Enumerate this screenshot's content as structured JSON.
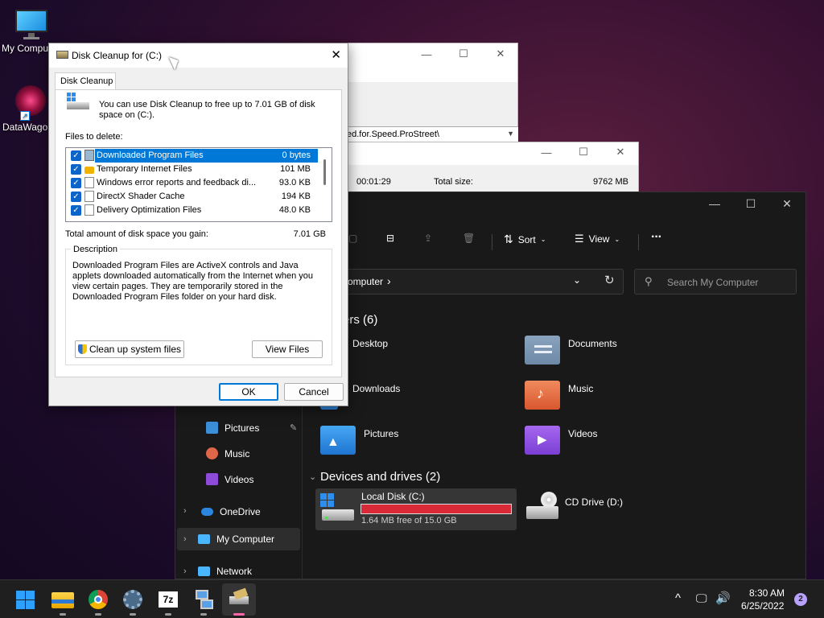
{
  "desktop": {
    "icons": [
      {
        "label": "My Computer"
      },
      {
        "label": "DataWagon"
      }
    ]
  },
  "bg_window_1": {
    "path_text": "ed.for.Speed.ProStreet\\"
  },
  "bg_window_2": {
    "elapsed": "00:01:29",
    "total_size_label": "Total size:",
    "total_size_value": "9762 MB"
  },
  "explorer": {
    "toolbar": {
      "sort_label": "Sort",
      "view_label": "View",
      "more_label": "···"
    },
    "address": {
      "crumb": "omputer",
      "chevron": "›"
    },
    "search": {
      "placeholder": "Search My Computer"
    },
    "sections": {
      "folders": "ers (6)",
      "devices": "Devices and drives (2)"
    },
    "folders": [
      {
        "label": "Desktop"
      },
      {
        "label": "Documents"
      },
      {
        "label": "Downloads"
      },
      {
        "label": "Music"
      },
      {
        "label": "Pictures"
      },
      {
        "label": "Videos"
      }
    ],
    "nav": [
      {
        "label": "Pictures"
      },
      {
        "label": "Music"
      },
      {
        "label": "Videos"
      },
      {
        "label": "OneDrive"
      },
      {
        "label": "My Computer"
      },
      {
        "label": "Network"
      }
    ],
    "drives": [
      {
        "label": "Local Disk (C:)",
        "free": "1.64 MB free of 15.0 GB",
        "used_fraction": 0.9999
      },
      {
        "label": "CD Drive (D:)"
      }
    ]
  },
  "dialog": {
    "title": "Disk Cleanup for  (C:)",
    "tab": "Disk Cleanup",
    "intro": "You can use Disk Cleanup to free up to 7.01 GB of disk space on  (C:).",
    "files_label": "Files to delete:",
    "files": [
      {
        "name": "Downloaded Program Files",
        "size": "0 bytes",
        "checked": true,
        "selected": true
      },
      {
        "name": "Temporary Internet Files",
        "size": "101 MB",
        "checked": true
      },
      {
        "name": "Windows error reports and feedback di...",
        "size": "93.0 KB",
        "checked": true
      },
      {
        "name": "DirectX Shader Cache",
        "size": "194 KB",
        "checked": true
      },
      {
        "name": "Delivery Optimization Files",
        "size": "48.0 KB",
        "checked": true
      }
    ],
    "total_label": "Total amount of disk space you gain:",
    "total_value": "7.01 GB",
    "description_label": "Description",
    "description_text": "Downloaded Program Files are ActiveX controls and Java applets downloaded automatically from the Internet when you view certain pages. They are temporarily stored in the Downloaded Program Files folder on your hard disk.",
    "cleanup_system_label": "Clean up system files",
    "view_files_label": "View Files",
    "ok_label": "OK",
    "cancel_label": "Cancel",
    "close_glyph": "✕"
  },
  "taskbar": {
    "apps": [
      {
        "name": "start-icon"
      },
      {
        "name": "file-explorer-icon"
      },
      {
        "name": "chrome-icon"
      },
      {
        "name": "settings-icon"
      },
      {
        "name": "7zip-icon",
        "label": "7z"
      },
      {
        "name": "network-tool-icon"
      },
      {
        "name": "disk-cleanup-icon"
      }
    ],
    "time": "8:30 AM",
    "date": "6/25/2022",
    "notif_count": "2",
    "chevron_up": "^"
  }
}
